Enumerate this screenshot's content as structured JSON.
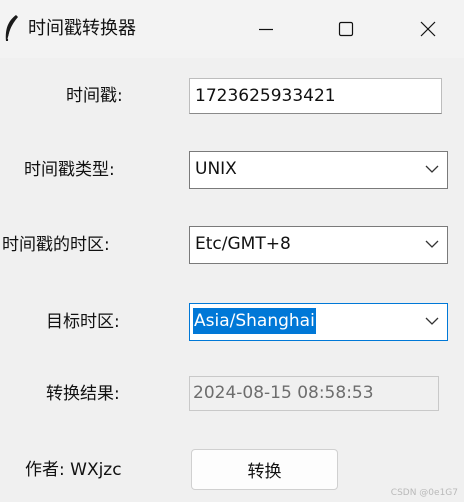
{
  "window": {
    "title": "时间戳转换器",
    "icons": {
      "app": "feather-icon",
      "minimize": "minimize-icon",
      "maximize": "maximize-icon",
      "close": "close-icon"
    }
  },
  "form": {
    "timestamp": {
      "label": "时间戳:",
      "value": "1723625933421"
    },
    "timestamp_type": {
      "label": "时间戳类型:",
      "selected": "UNIX"
    },
    "source_timezone": {
      "label": "时间戳的时区:",
      "selected": "Etc/GMT+8"
    },
    "target_timezone": {
      "label": "目标时区:",
      "selected": "Asia/Shanghai"
    },
    "result": {
      "label": "转换结果:",
      "value": "2024-08-15 08:58:53"
    }
  },
  "footer": {
    "author": "作者: WXjzc",
    "convert_button": "转换"
  },
  "watermark": "CSDN @0e1G7",
  "colors": {
    "focus": "#0078d7",
    "window_bg": "#f0f0f0"
  }
}
